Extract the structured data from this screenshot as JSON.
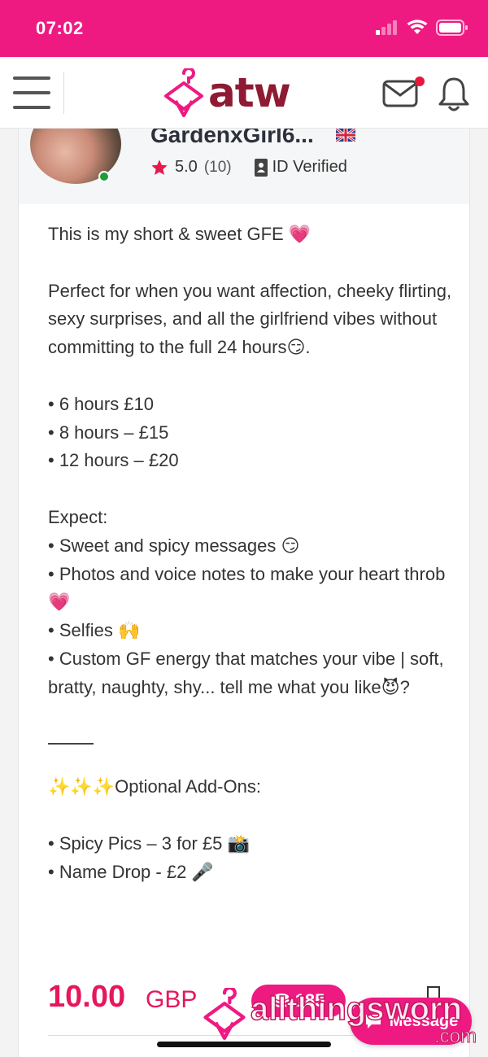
{
  "status_bar": {
    "time": "07:02",
    "icons": [
      "cellular-signal-icon",
      "wifi-icon",
      "battery-icon"
    ]
  },
  "header": {
    "logo_text": "atw",
    "icons": [
      "menu-icon",
      "mail-icon",
      "bell-icon"
    ]
  },
  "profile": {
    "username": "GardenxGirl6...",
    "country_flag": "uk-flag-icon",
    "rating": "5.0",
    "rating_count": "(10)",
    "verified_label": "ID Verified"
  },
  "description": {
    "intro": "This is my short & sweet GFE 💗",
    "perfect_for": "Perfect for when you want affection, cheeky flirting, sexy surprises, and all the girlfriend vibes without committing to the full 24 hours😏.",
    "durations": [
      "• 6 hours £10",
      "• 8 hours – £15",
      "• 12 hours – £20"
    ],
    "expect_heading": "Expect:",
    "expect_items": [
      "• Sweet and spicy messages 😏",
      "• Photos and voice notes to make your heart throb💗",
      "• Selfies 🙌",
      "• Custom GF energy that matches your vibe | soft, bratty, naughty, shy... tell me what you like😈?"
    ],
    "addons_heading": "✨✨✨Optional Add-Ons:",
    "addons": [
      "• Spicy Pics – 3 for £5 📸",
      "• Name Drop - £2 🎤"
    ]
  },
  "purchase": {
    "price": "10.00",
    "currency": "GBP",
    "coins": "185"
  },
  "message_button": {
    "label": "Message"
  },
  "watermark": {
    "text": "allthingsworn",
    "sub": ".com"
  },
  "colors": {
    "brand_pink": "#ee1a82",
    "logo_maroon": "#8e1a33",
    "price_pink": "#e6175c",
    "star": "#e8174e",
    "online": "#1e9e3a"
  }
}
